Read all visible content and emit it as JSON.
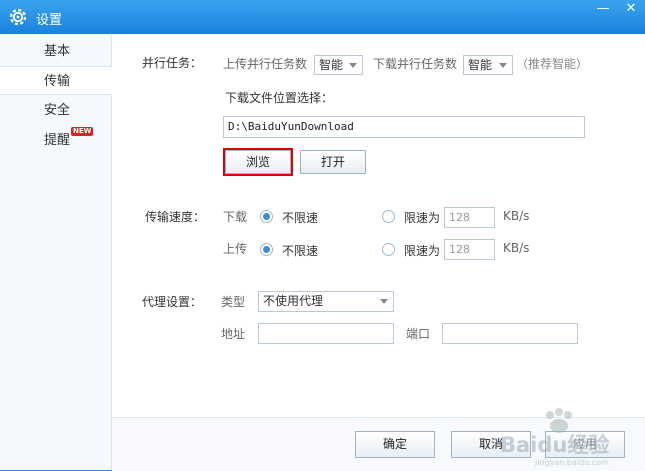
{
  "window": {
    "title": "设置",
    "minimize_label": "—",
    "close_label": "✕"
  },
  "sidebar": {
    "items": [
      {
        "label": "基本"
      },
      {
        "label": "传输"
      },
      {
        "label": "安全"
      },
      {
        "label": "提醒",
        "badge": "NEW"
      }
    ],
    "active": "传输"
  },
  "parallel": {
    "section_label": "并行任务：",
    "upload_label": "上传并行任务数",
    "upload_value": "智能",
    "download_label": "下载并行任务数",
    "download_value": "智能",
    "hint": "（推荐智能）"
  },
  "location": {
    "label": "下载文件位置选择：",
    "path": "D:\\BaiduYunDownload",
    "browse_label": "浏览",
    "open_label": "打开"
  },
  "speed": {
    "section_label": "传输速度：",
    "download": {
      "label": "下载",
      "unlimited_label": "不限速",
      "limit_label": "限速为",
      "limit_value": "128",
      "unit": "KB/s",
      "selected": "unlimited"
    },
    "upload": {
      "label": "上传",
      "unlimited_label": "不限速",
      "limit_label": "限速为",
      "limit_value": "128",
      "unit": "KB/s",
      "selected": "unlimited"
    }
  },
  "proxy": {
    "section_label": "代理设置：",
    "type_label": "类型",
    "type_value": "不使用代理",
    "address_label": "地址",
    "address_value": "",
    "port_label": "端口",
    "port_value": ""
  },
  "footer": {
    "ok_label": "确定",
    "cancel_label": "取消",
    "apply_label": "应用"
  },
  "watermark": {
    "text": "Baidu经验",
    "sub": "jingyan.baidu.com"
  }
}
